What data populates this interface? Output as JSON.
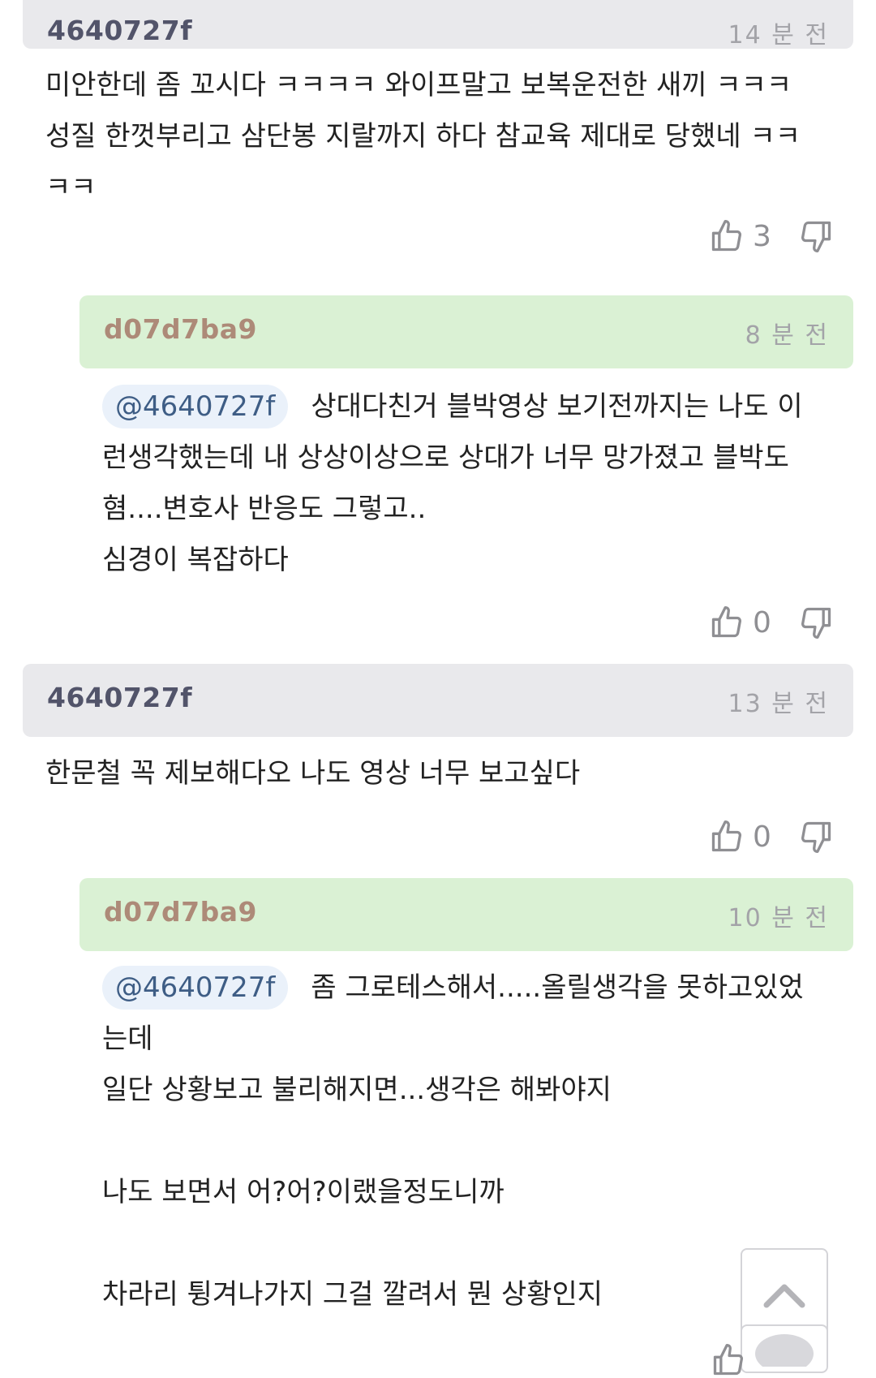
{
  "comments": [
    {
      "author": "4640727f",
      "time": "14 분 전",
      "text": "미안한데 좀 꼬시다 ㅋㅋㅋㅋ 와이프말고 보복운전한 새끼 ㅋㅋㅋ\n성질 한껏부리고 삼단봉 지랄까지 하다 참교육 제대로 당했네 ㅋㅋ\nㅋㅋ",
      "likes": "3"
    },
    {
      "author": "d07d7ba9",
      "time": "8 분 전",
      "mention": "@4640727f",
      "text": "상대다친거 블박영상 보기전까지는 나도 이\n런생각했는데 내 상상이상으로 상대가 너무 망가졌고 블박도\n혐....변호사 반응도 그렇고..\n심경이 복잡하다",
      "likes": "0"
    },
    {
      "author": "4640727f",
      "time": "13 분 전",
      "text": "한문철 꼭 제보해다오 나도 영상 너무 보고싶다",
      "likes": "0"
    },
    {
      "author": "d07d7ba9",
      "time": "10 분 전",
      "mention": "@4640727f",
      "text": "좀 그로테스해서.....올릴생각을 못하고있었\n는데\n일단 상황보고 불리해지면...생각은 해봐야지\n\n나도 보면서 어?어?이랬을정도니까\n\n차라리 튕겨나가지 그걸 깔려서 뭔 상황인지"
    }
  ],
  "icons": {
    "like": "thumbs-up-icon",
    "dislike": "thumbs-down-icon",
    "scroll_top": "chevron-up-icon"
  },
  "colors": {
    "header_gray": "#e9e9ec",
    "header_green": "#daf1d4",
    "author_gray": "#52546a",
    "author_brown": "#ad8a78"
  }
}
